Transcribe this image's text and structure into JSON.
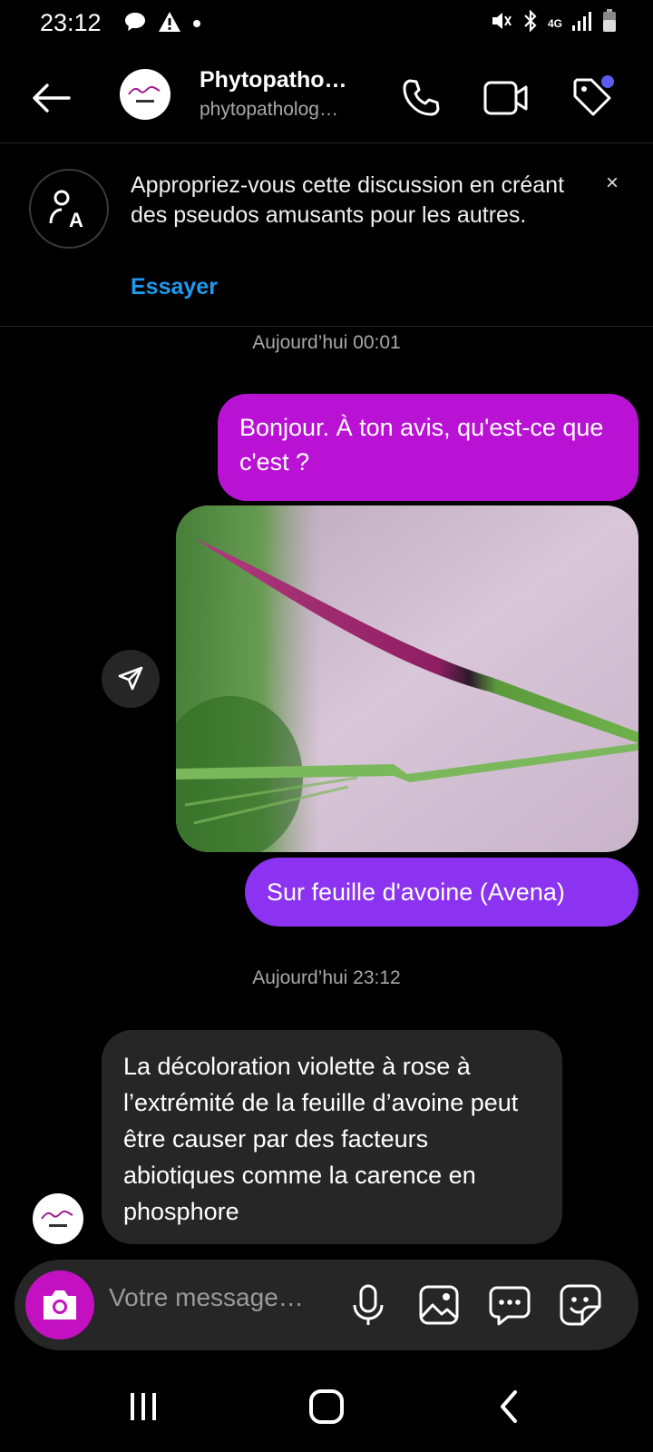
{
  "status_bar": {
    "time": "23:12",
    "network": "4G",
    "icons": [
      "chat-bubble-icon",
      "warning-icon",
      "dot-icon",
      "mute-icon",
      "bluetooth-icon",
      "signal-icon",
      "battery-icon"
    ]
  },
  "header": {
    "title": "Phytopatho…",
    "subtitle": "phytopatholog…",
    "icons": [
      "back-arrow-icon",
      "phone-icon",
      "video-icon",
      "tag-icon"
    ],
    "tag_badge_color": "#5b5bf0"
  },
  "notice": {
    "text": "Appropriez-vous cette discussion en créant des pseudos amusants pour les autres.",
    "link": "Essayer",
    "close": "×"
  },
  "messages": {
    "timestamp_1": "Aujourd’hui 00:01",
    "msg_1": "Bonjour. À ton avis, qu'est-ce que c'est ?",
    "msg_2": "Sur feuille d'avoine (Avena)",
    "timestamp_2": "Aujourd’hui 23:12",
    "msg_3": "La décoloration violette à rose à l’extrémité de la feuille d’avoine peut être causer par des facteurs abiotiques comme la carence en phosphore"
  },
  "composer": {
    "placeholder": "Votre message…",
    "icons": [
      "camera-icon",
      "microphone-icon",
      "gallery-icon",
      "chat-options-icon",
      "sticker-icon"
    ]
  },
  "colors": {
    "sent_bubble_1": "#b912d5",
    "sent_bubble_2": "#8b33f0",
    "received_bubble": "#262626",
    "camera_button": "#c311c2",
    "link": "#1e9bf0"
  }
}
